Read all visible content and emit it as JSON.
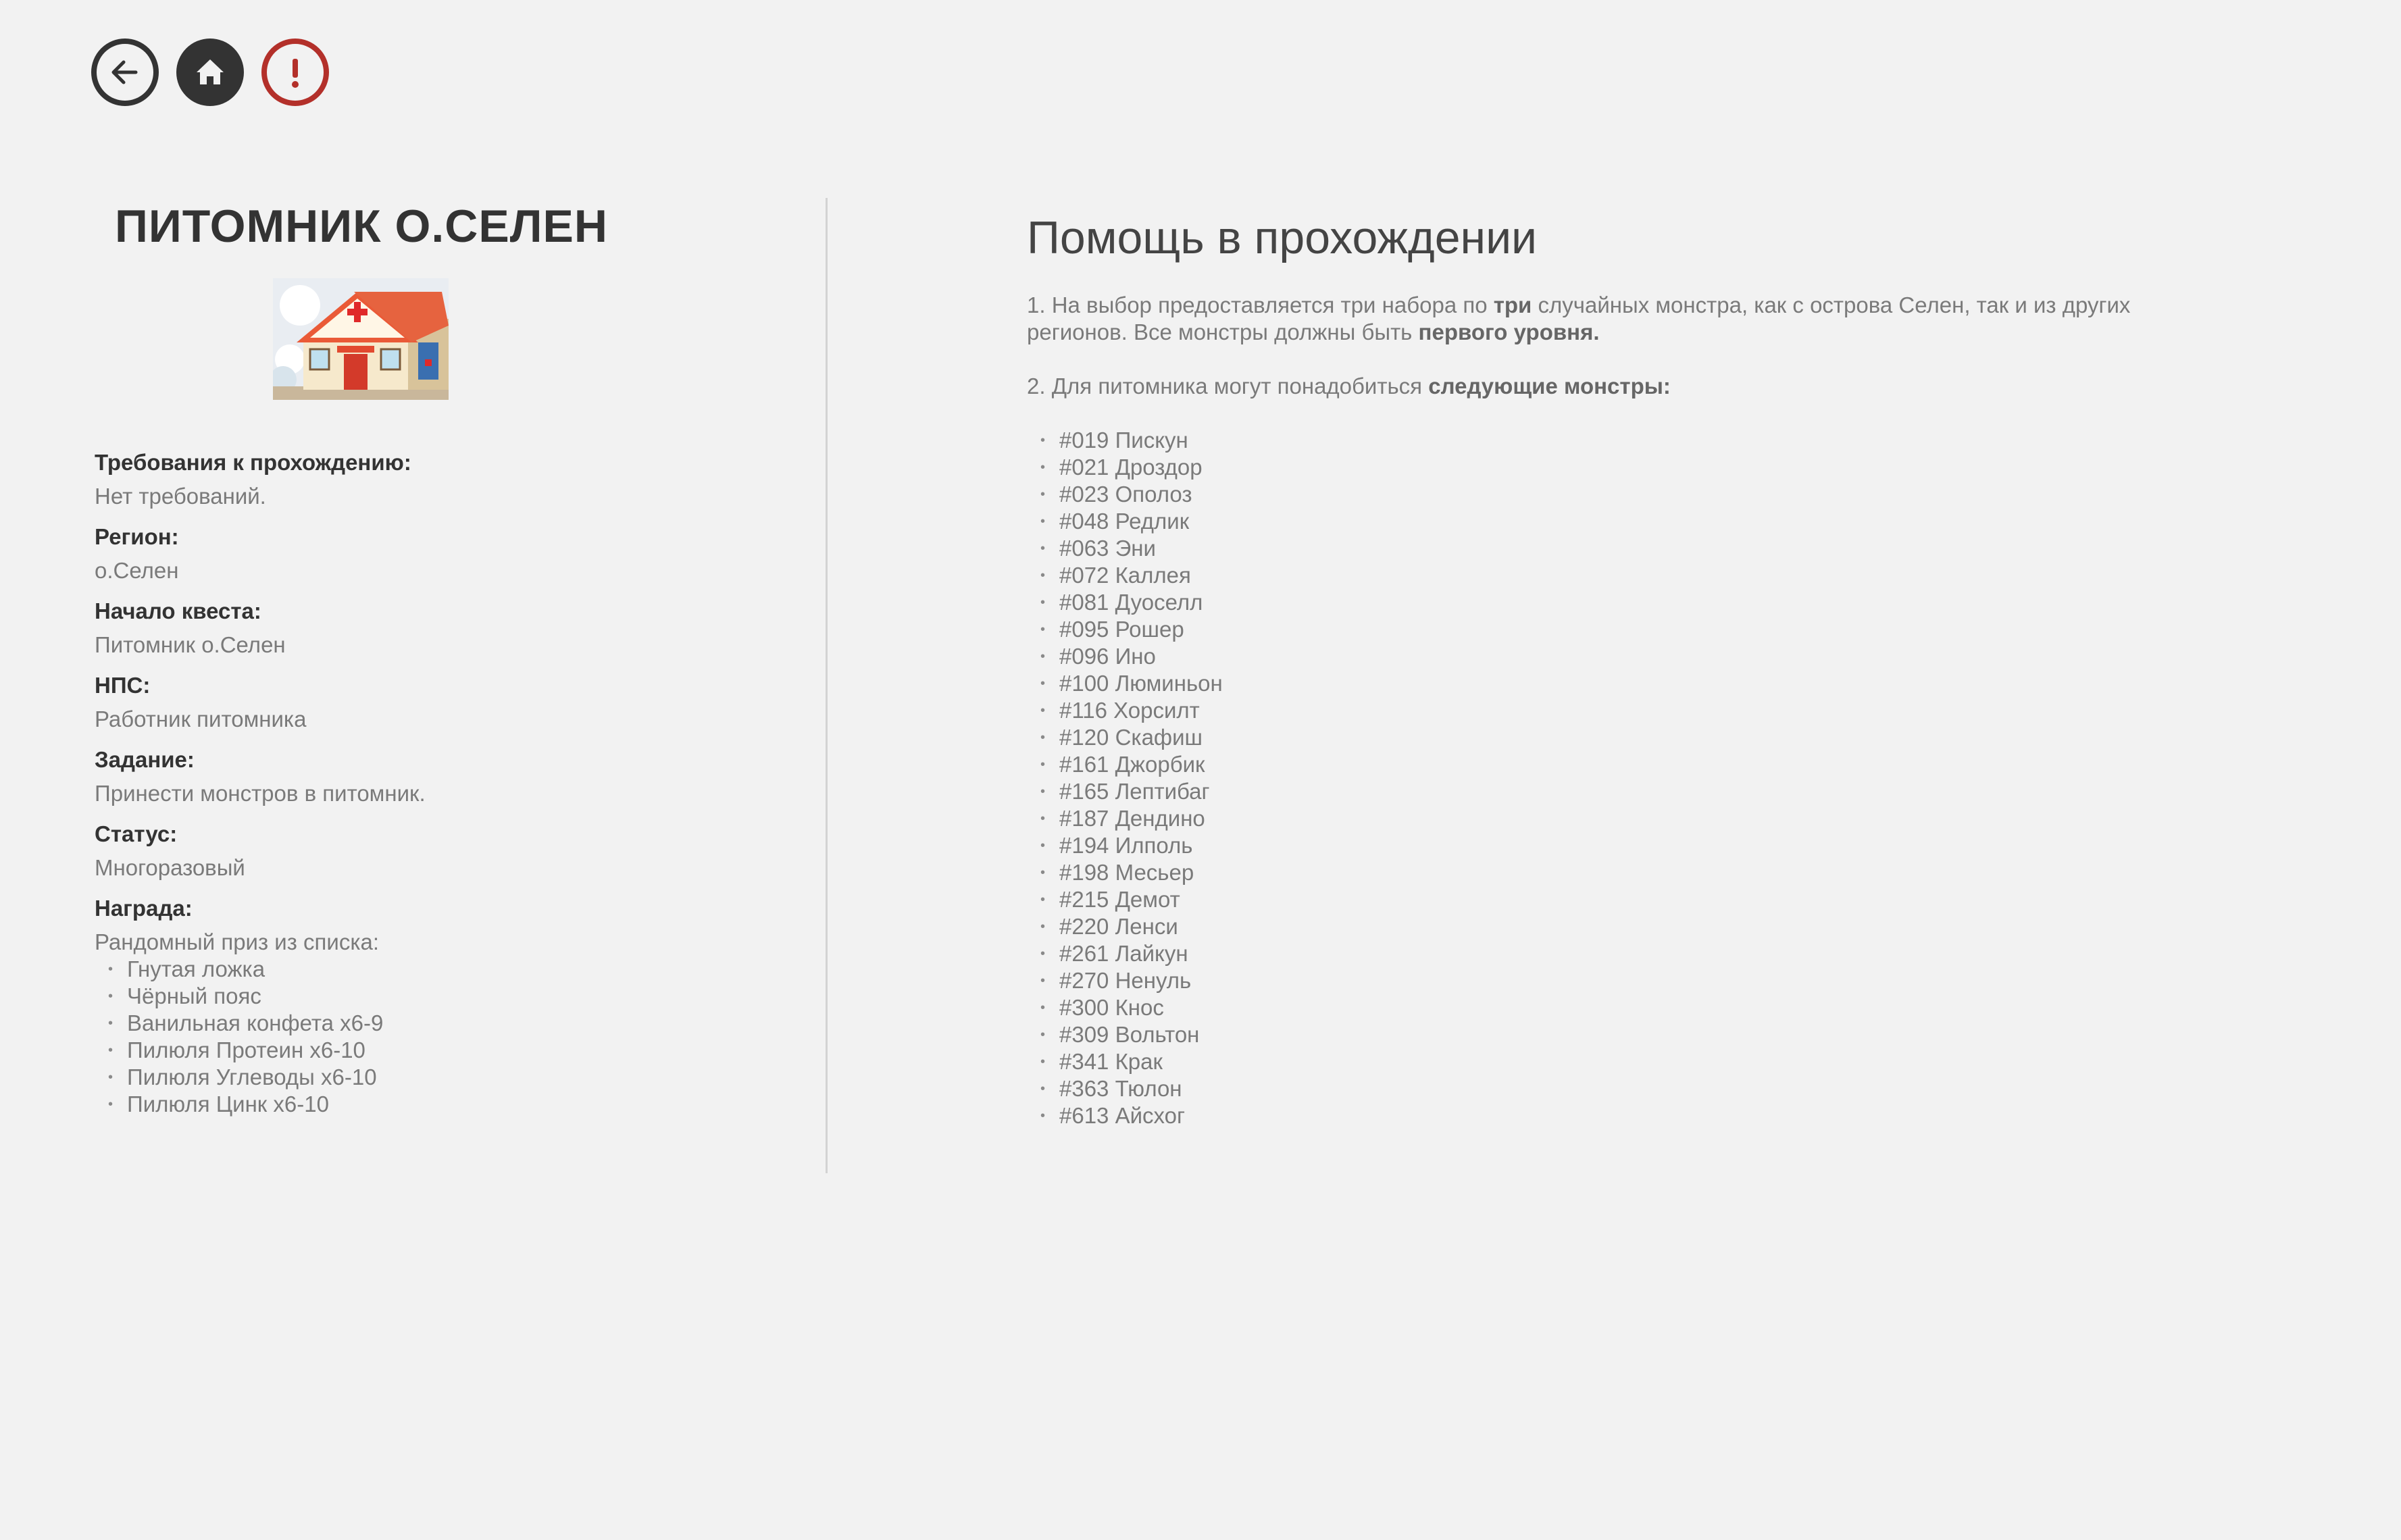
{
  "nav": {
    "back_icon": "arrow-left-icon",
    "home_icon": "home-icon",
    "alert_icon": "exclamation-icon",
    "alert_color": "#b3302a",
    "dark_color": "#333333"
  },
  "quest": {
    "title": "ПИТОМНИК О.СЕЛЕН",
    "image": "nursery-house-illustration",
    "requirements_label": "Требования к прохождению:",
    "requirements_value": "Нет требований.",
    "region_label": "Регион:",
    "region_value": "о.Селен",
    "start_label": "Начало квеста:",
    "start_value": "Питомник о.Селен",
    "npc_label": "НПС:",
    "npc_value": "Работник питомника",
    "task_label": "Задание:",
    "task_value": "Принести монстров в питомник.",
    "status_label": "Статус:",
    "status_value": "Многоразовый",
    "reward_label": "Награда:",
    "reward_intro": "Рандомный приз из списка:",
    "rewards": [
      "Гнутая ложка",
      "Чёрный пояс",
      "Ванильная конфета х6-9",
      "Пилюля Протеин х6-10",
      "Пилюля Углеводы х6-10",
      "Пилюля Цинк х6-10"
    ]
  },
  "help": {
    "title": "Помощь в прохождении",
    "p1_a": "1. На выбор предоставляется три набора по ",
    "p1_b": "три",
    "p1_c": " случайных монстра, как с острова Селен, так и из других регионов. Все монстры должны быть ",
    "p1_d": "первого уровня.",
    "p2_a": "2. Для питомника могут понадобиться ",
    "p2_b": "следующие монстры:",
    "monsters": [
      "#019 Пискун",
      "#021 Дроздор",
      "#023 Ополоз",
      "#048 Редлик",
      "#063 Эни",
      "#072 Каллея",
      "#081 Дуоселл",
      "#095 Рошер",
      "#096 Ино",
      "#100 Люминьон",
      "#116 Хорсилт",
      "#120 Скафиш",
      "#161 Джорбик",
      "#165 Лептибаг",
      "#187 Дендино",
      "#194 Илполь",
      "#198 Месьер",
      "#215 Демот",
      "#220 Ленси",
      "#261 Лайкун",
      "#270 Ненуль",
      "#300 Кнос",
      "#309 Вольтон",
      "#341 Крак",
      "#363 Тюлон",
      "#613 Айсхог"
    ]
  }
}
